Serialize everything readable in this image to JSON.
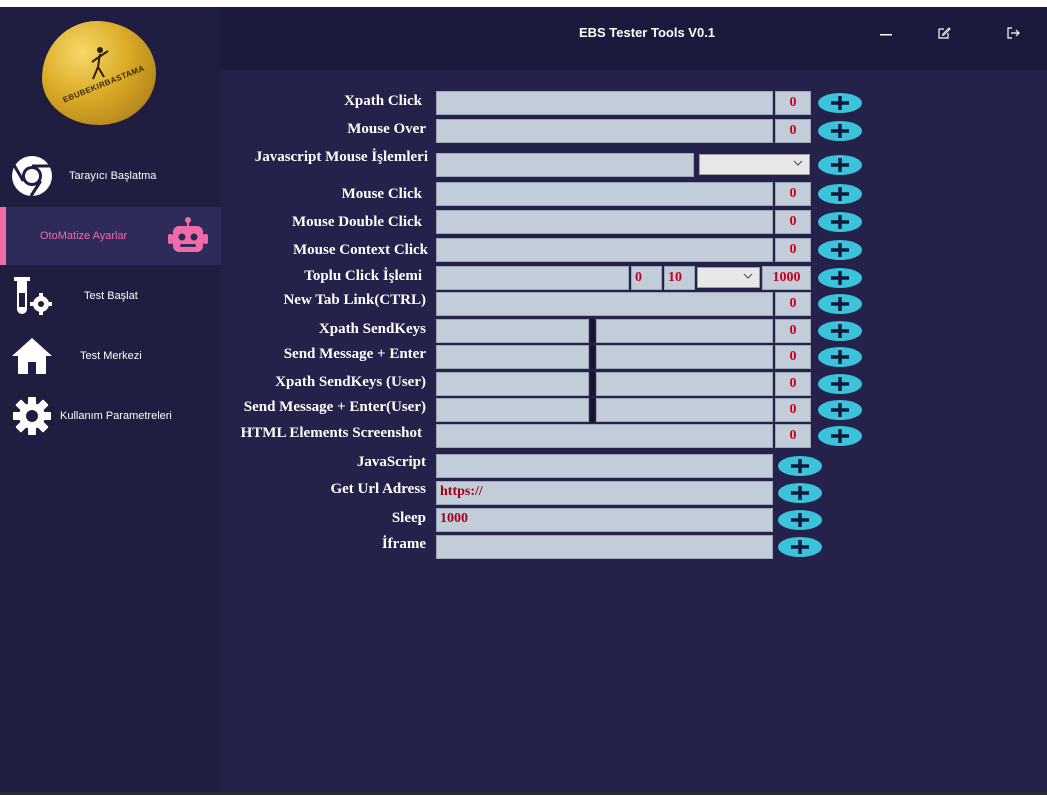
{
  "window": {
    "title": "EBS Tester Tools V0.1"
  },
  "header": {
    "title": "EBS Tester Tools V0.1",
    "buttons": {
      "minimize": "minimize-icon",
      "edit": "edit-icon",
      "exit": "logout-icon"
    }
  },
  "logo": {
    "text": "EBUBEKIRBASTAMA"
  },
  "sidebar": {
    "accent_color": "#f06ba8",
    "items": [
      {
        "label": "Tarayıcı Başlatma",
        "icon": "chrome-icon"
      },
      {
        "label": "OtoMatize Ayarlar",
        "icon": "robot-icon",
        "active": true
      },
      {
        "label": "Test Başlat",
        "icon": "lab-gear-icon"
      },
      {
        "label": "Test Merkezi",
        "icon": "home-icon"
      },
      {
        "label": "Kullanım Parametreleri",
        "icon": "gear-icon"
      }
    ]
  },
  "form": {
    "rows": [
      {
        "label": "Xpath Click",
        "count": "0"
      },
      {
        "label": "Mouse Over",
        "count": "0"
      },
      {
        "label": "Javascript Mouse İşlemleri",
        "select": ""
      },
      {
        "label": "Mouse Click",
        "count": "0"
      },
      {
        "label": "Mouse Double Click",
        "count": "0"
      },
      {
        "label": "Mouse Context Click",
        "count": "0"
      },
      {
        "label": "Toplu Click İşlemi",
        "start": "0",
        "step": "10",
        "select": "",
        "count": "1000"
      },
      {
        "label": "New Tab Link(CTRL)",
        "count": "0"
      },
      {
        "label": "Xpath SendKeys",
        "count": "0"
      },
      {
        "label": "Send Message + Enter",
        "count": "0"
      },
      {
        "label": "Xpath SendKeys (User)",
        "count": "0"
      },
      {
        "label": "Send Message + Enter(User)",
        "count": "0"
      },
      {
        "label": "HTML Elements Screenshot",
        "count": "0"
      },
      {
        "label": "JavaScript",
        "value": ""
      },
      {
        "label": "Get Url Adress",
        "value": "https://"
      },
      {
        "label": "Sleep",
        "value": "1000"
      },
      {
        "label": "İframe",
        "value": ""
      }
    ]
  },
  "colors": {
    "background": "#24214a",
    "sidebar": "#1f1d40",
    "field": "#c2cdd9",
    "count_text": "#c8001e",
    "add_button": "#3cc3dc"
  }
}
